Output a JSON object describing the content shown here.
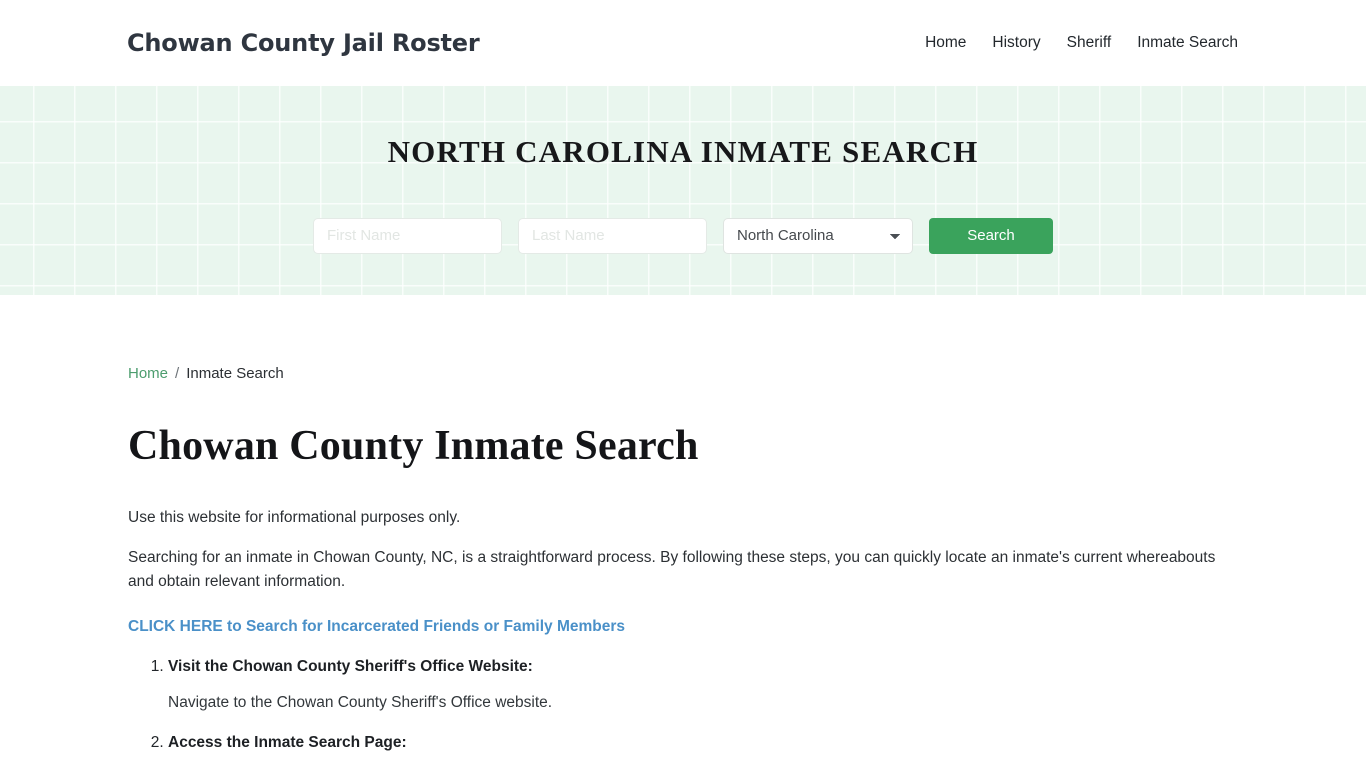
{
  "header": {
    "site_title": "Chowan County Jail Roster",
    "nav": [
      {
        "label": "Home"
      },
      {
        "label": "History"
      },
      {
        "label": "Sheriff"
      },
      {
        "label": "Inmate Search"
      }
    ]
  },
  "hero": {
    "title": "NORTH CAROLINA INMATE SEARCH",
    "first_name_placeholder": "First Name",
    "first_name_value": "",
    "last_name_placeholder": "Last Name",
    "last_name_value": "",
    "state_selected": "North Carolina",
    "search_button": "Search",
    "background_color": "#e9f6ee"
  },
  "breadcrumb": {
    "home": "Home",
    "separator": "/",
    "current": "Inmate Search"
  },
  "main": {
    "page_title": "Chowan County Inmate Search",
    "intro": "Use this website for informational purposes only.",
    "description": "Searching for an inmate in Chowan County, NC, is a straightforward process. By following these steps, you can quickly locate an inmate's current whereabouts and obtain relevant information.",
    "cta_link": "CLICK HERE to Search for Incarcerated Friends or Family Members",
    "cta_color": "#4a90c8",
    "steps": [
      {
        "title": "Visit the Chowan County Sheriff's Office Website:",
        "description": "Navigate to the Chowan County Sheriff's Office website."
      },
      {
        "title": "Access the Inmate Search Page:",
        "description": ""
      }
    ]
  }
}
